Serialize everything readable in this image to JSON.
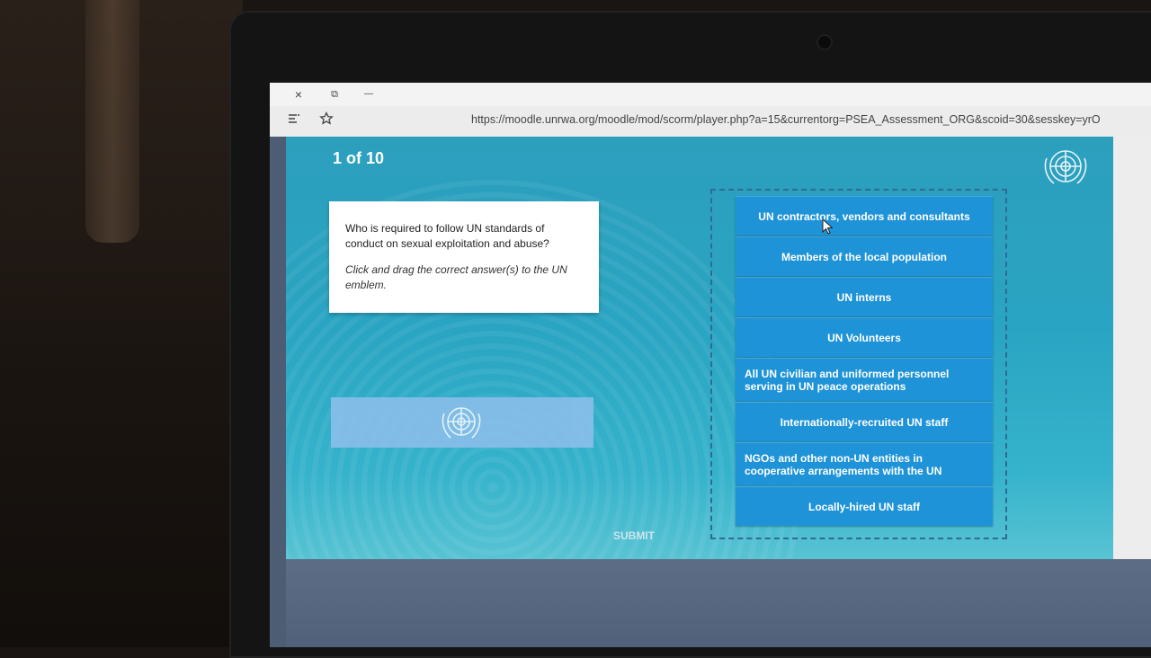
{
  "browser": {
    "titlebar": {
      "close": "×",
      "restore": "⧉",
      "minimize": "—"
    },
    "url": "https://moodle.unrwa.org/moodle/mod/scorm/player.php?a=15&currentorg=PSEA_Assessment_ORG&scoid=30&sesskey=yrO"
  },
  "quiz": {
    "counter": "1 of 10",
    "question": "Who is required to follow UN standards of conduct on sexual exploitation and abuse?",
    "instruction": "Click and drag the correct answer(s) to the UN emblem.",
    "answers": [
      "UN contractors, vendors and consultants",
      "Members of the local population",
      "UN interns",
      "UN Volunteers",
      "All UN civilian and uniformed personnel serving in UN peace operations",
      "Internationally-recruited UN staff",
      "NGOs and other non-UN entities in cooperative arrangements with the UN",
      "Locally-hired UN staff"
    ],
    "submit": "SUBMIT"
  },
  "colors": {
    "content_bg": "#2ca0be",
    "answer_bg": "#1f93d8",
    "drop_target": "#8fbfec",
    "footer": "#56667f"
  },
  "icons": [
    "un-emblem-icon",
    "mouse-cursor-icon",
    "reading-list-icon",
    "favorite-star-icon"
  ]
}
